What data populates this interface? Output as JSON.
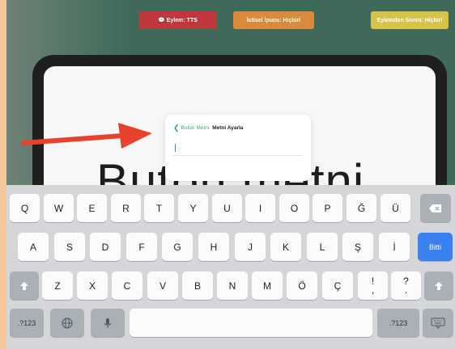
{
  "top_bar": {
    "action_label": "💬 Eylem: TTS",
    "hint_label": "İstisel İpucu: Hiçbiri",
    "done_label": "Eylemden Sonra: Hiçbiri"
  },
  "canvas": {
    "big_text": "Buton metni"
  },
  "popover": {
    "back_label": "Buton Metni",
    "title": "Metni Ayarla",
    "input_value": ""
  },
  "keyboard": {
    "row1": [
      "Q",
      "W",
      "E",
      "R",
      "T",
      "Y",
      "U",
      "I",
      "O",
      "P",
      "Ğ",
      "Ü"
    ],
    "row2": [
      "A",
      "S",
      "D",
      "F",
      "G",
      "H",
      "J",
      "K",
      "L",
      "Ş",
      "İ"
    ],
    "row3": [
      "Z",
      "X",
      "C",
      "V",
      "B",
      "N",
      "M",
      "Ö",
      "Ç"
    ],
    "exclaim": {
      "top": "!",
      "bottom": ","
    },
    "question": {
      "top": "?",
      "bottom": "."
    },
    "done_label": "Bitti",
    "numbers_left": ".?123",
    "numbers_right": ".?123"
  },
  "icons": {
    "delete": "delete-icon",
    "shift_left": "shift-icon",
    "shift_right": "shift-icon",
    "globe": "globe-icon",
    "mic": "mic-icon",
    "hide_keyboard": "keyboard-hide-icon",
    "arrow": "red-arrow-annotation"
  },
  "colors": {
    "action_btn": "#c0363a",
    "hint_btn": "#d98a3a",
    "done_btn": "#d7c24a",
    "accent_green": "#39a86a",
    "done_key": "#3a80f3",
    "arrow": "#e8412c"
  }
}
